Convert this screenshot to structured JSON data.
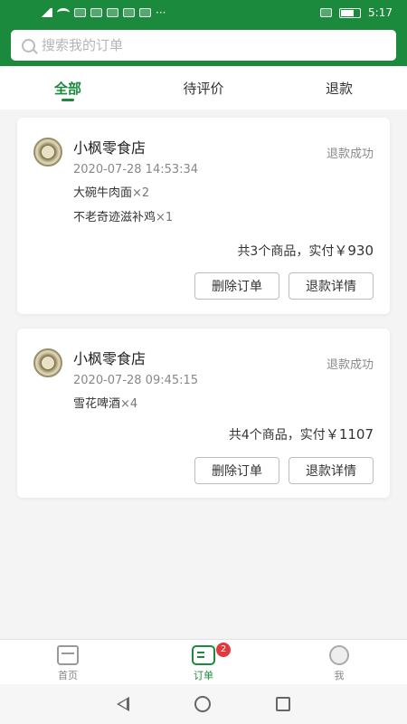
{
  "status_bar": {
    "time": "5:17",
    "battery": "",
    "dots": "···"
  },
  "search": {
    "placeholder": "搜索我的订单"
  },
  "tabs": [
    {
      "label": "全部",
      "active": true
    },
    {
      "label": "待评价",
      "active": false
    },
    {
      "label": "退款",
      "active": false
    }
  ],
  "orders": [
    {
      "shop_name": "小枫零食店",
      "time": "2020-07-28 14:53:34",
      "status": "退款成功",
      "items": [
        {
          "name": "大碗牛肉面",
          "qty": "×2"
        },
        {
          "name": "不老奇迹滋补鸡",
          "qty": "×1"
        }
      ],
      "total_text": "共3个商品，实付",
      "amount": "￥930",
      "delete_label": "删除订单",
      "refund_label": "退款详情"
    },
    {
      "shop_name": "小枫零食店",
      "time": "2020-07-28 09:45:15",
      "status": "退款成功",
      "items": [
        {
          "name": "雪花啤酒",
          "qty": "×4"
        }
      ],
      "total_text": "共4个商品，实付",
      "amount": "￥1107",
      "delete_label": "删除订单",
      "refund_label": "退款详情"
    }
  ],
  "bottom_nav": [
    {
      "label": "首页",
      "icon": "home-icon"
    },
    {
      "label": "订单",
      "icon": "order-icon",
      "badge": "2"
    },
    {
      "label": "我",
      "icon": "profile-icon"
    }
  ],
  "colors": {
    "brand": "#1b8a3c",
    "badge": "#e0393e"
  }
}
